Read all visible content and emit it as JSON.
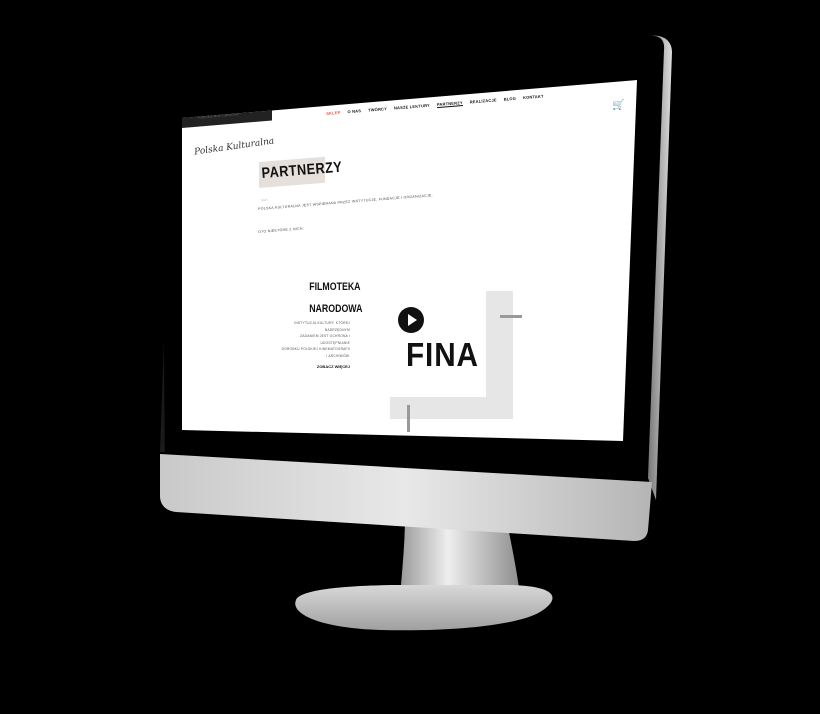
{
  "site": {
    "logo": "Polska Kulturalna",
    "dark_strip": "POLSKA KULTURALNA",
    "nav": [
      {
        "label": "SKLEP",
        "state": "active"
      },
      {
        "label": "O NAS",
        "state": "normal"
      },
      {
        "label": "TWÓRCY",
        "state": "normal"
      },
      {
        "label": "NASZE LEKTURY",
        "state": "normal"
      },
      {
        "label": "PARTNERZY",
        "state": "current"
      },
      {
        "label": "REALIZACJE",
        "state": "normal"
      },
      {
        "label": "BLOG",
        "state": "normal"
      },
      {
        "label": "KONTAKT",
        "state": "normal"
      }
    ],
    "top_icons": [
      "instagram-icon",
      "facebook-icon"
    ],
    "cart_icon": "cart-icon"
  },
  "page": {
    "title": "PARTNERZY",
    "breadcrumb": "Start",
    "intro_line1": "POLSKA KULTURALNA JEST WSPIERANA PRZEZ INSTYTUCJE, FUNDACJE I ORGANIZACJE.",
    "intro_line2": "OTO NIEKTÓRE Z NICH:"
  },
  "partner": {
    "name_line1": "FILMOTEKA",
    "name_line2": "NARODOWA",
    "desc_line1": "INSTYTUCJA KULTURY, KTÓREJ NADRZĘDNYM",
    "desc_line2": "ZADANIEM JEST OCHRONA I UDOSTĘPNIANIE",
    "desc_line3": "DOROBKU POLSKIEJ KINEMATOGRAFII",
    "desc_line4": "I ARCHIWÓW.",
    "link": "ZOBACZ WIĘCEJ",
    "logo_text": "FINA",
    "logo_icon": "play-icon"
  },
  "colors": {
    "accent": "#e6553a",
    "text": "#111111",
    "title_bg": "#e5e0dc"
  }
}
